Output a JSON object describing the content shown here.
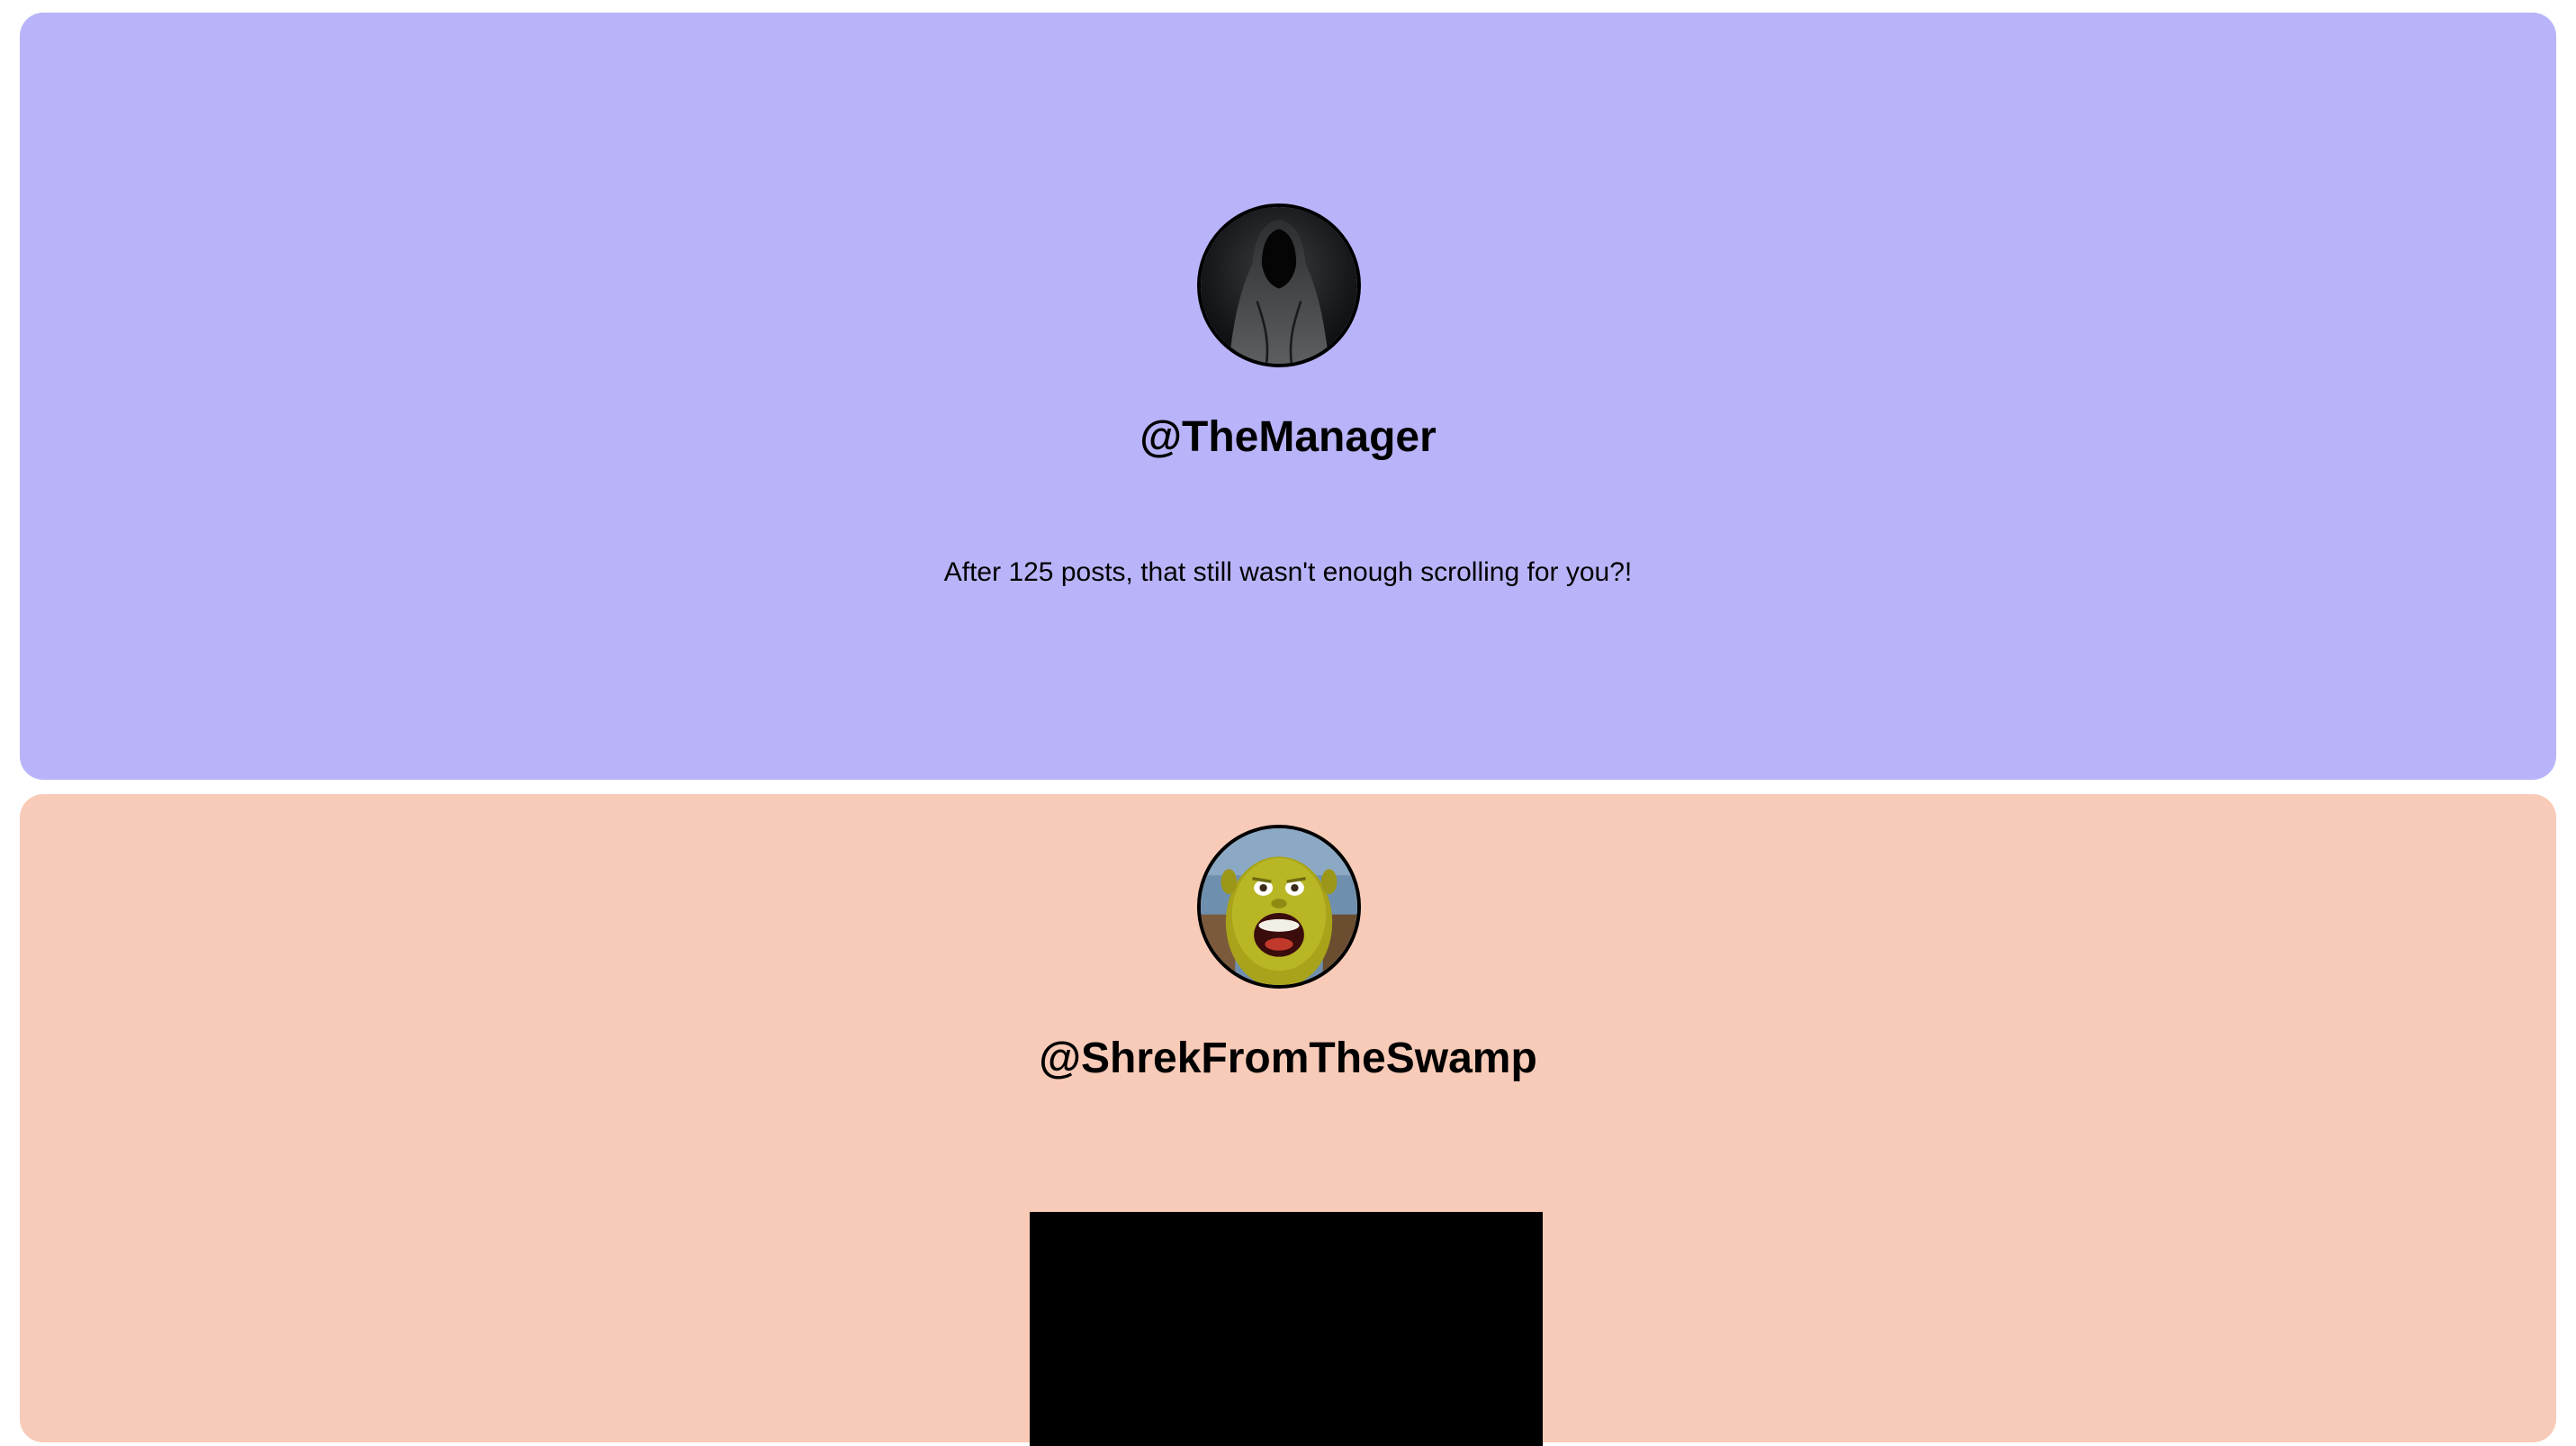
{
  "colors": {
    "post_1_background": "#b9b4f9",
    "post_2_background": "#f8cbb8",
    "page_background": "#ffffff",
    "media_background": "#000000"
  },
  "posts": [
    {
      "username": "@TheManager",
      "avatar_icon": "hooded-figure-avatar",
      "text": "After 125 posts, that still wasn't enough scrolling for you?!"
    },
    {
      "username": "@ShrekFromTheSwamp",
      "avatar_icon": "screaming-ogre-avatar",
      "media": "black-video-block"
    }
  ]
}
